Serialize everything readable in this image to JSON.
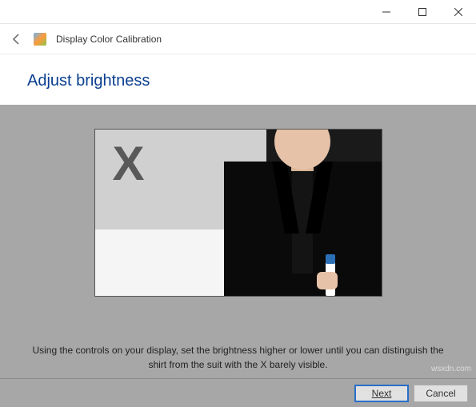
{
  "window": {
    "app_title": "Display Color Calibration"
  },
  "page": {
    "heading": "Adjust brightness",
    "instruction": "Using the controls on your display, set the brightness higher or lower until you can distinguish the shirt from the suit with the X barely visible."
  },
  "footer": {
    "next_label": "Next",
    "cancel_label": "Cancel"
  },
  "watermark": "wsxdn.com"
}
